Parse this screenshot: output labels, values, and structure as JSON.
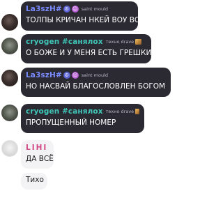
{
  "messages": [
    {
      "author": "La3szH#",
      "tag": "saint mould",
      "text": "ТОЛПЫ КРИЧАН НКЕЙ ВОУ ВОУ"
    },
    {
      "author": "cryogen #санялох",
      "tag": "техно drave",
      "text": "О БОЖЕ И У МЕНЯ ЕСТЬ ГРЕШКИ"
    },
    {
      "author": "La3szH#",
      "tag": "saint mould",
      "text": "НО НАСВАЙ БЛАГОСЛОВЛЕН БОГОМ"
    },
    {
      "author": "cryogen #санялох",
      "tag": "техно drave",
      "text": "ПРОПУЩЕННЫЙ НОМЕР"
    },
    {
      "author": "LIHI",
      "text": "ДА ВСЁ"
    },
    {
      "text": "Тихо"
    }
  ],
  "icons": {
    "peace": "☮",
    "emoji": "☺"
  }
}
